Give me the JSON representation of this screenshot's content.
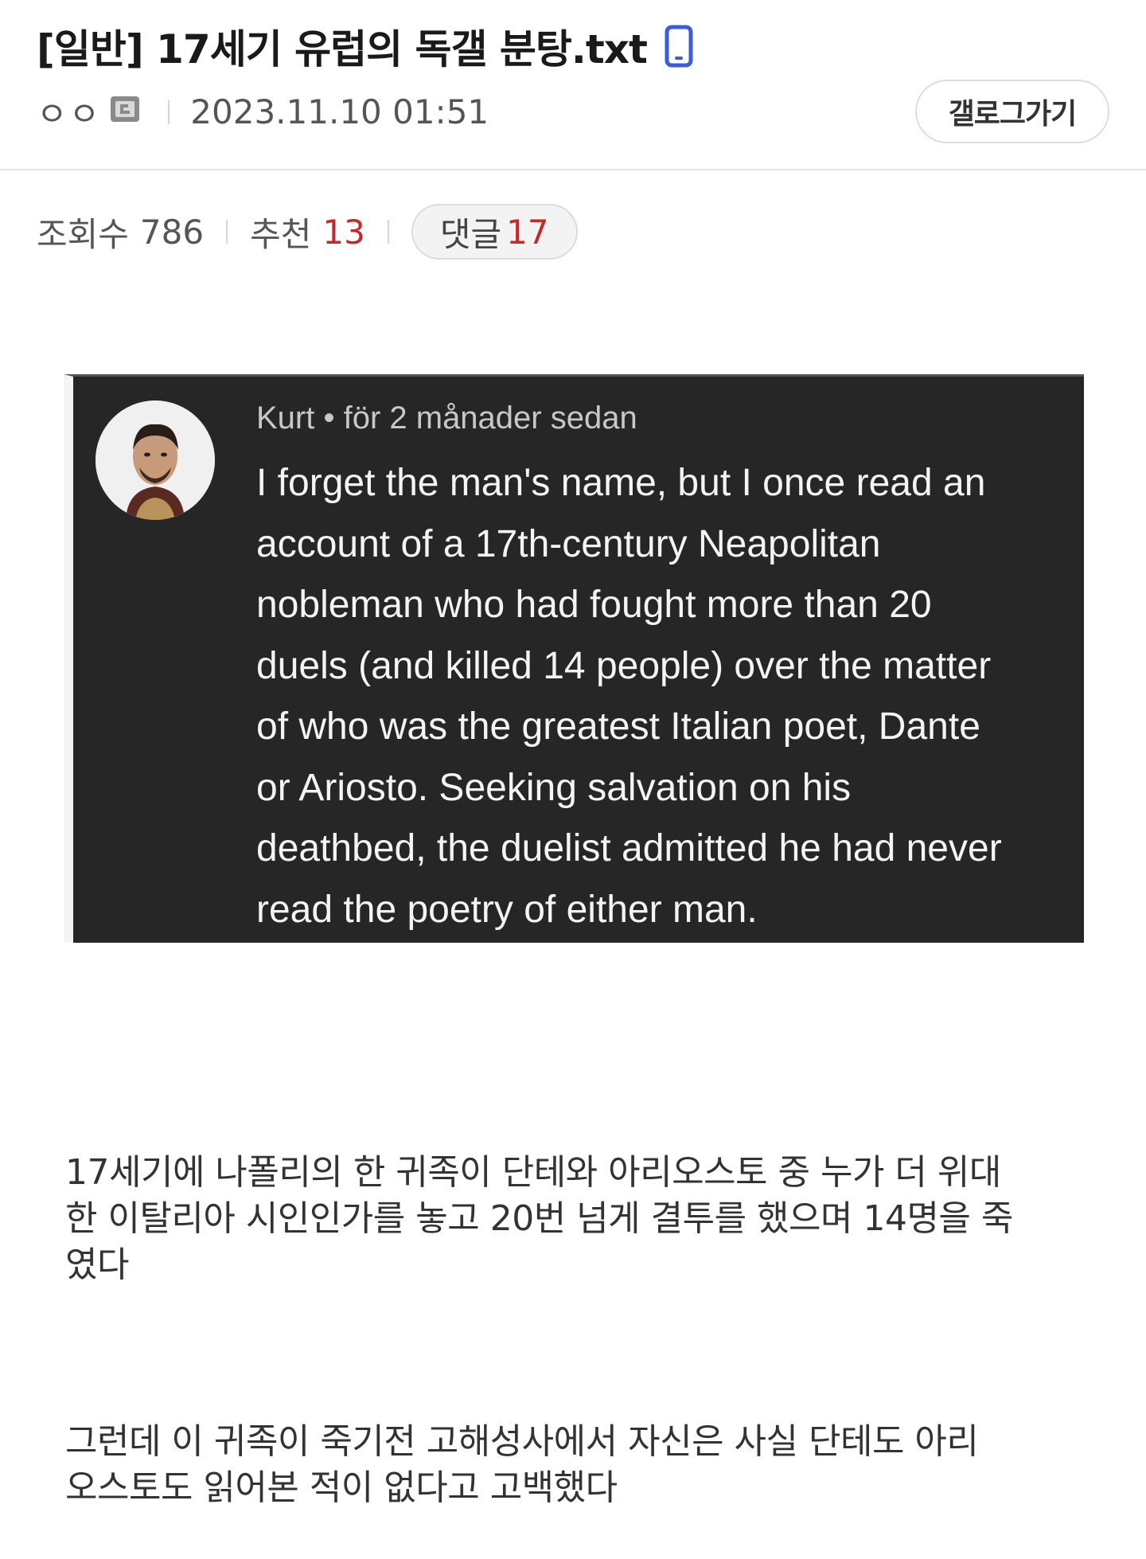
{
  "post": {
    "title": "[일반] 17세기 유럽의 독갤 분탕.txt",
    "author": "ㅇㅇ",
    "date": "2023.11.10 01:51",
    "gallog_button": "갤로그가기",
    "views_label": "조회수",
    "views": "786",
    "recommend_label": "추천",
    "recommend": "13",
    "comments_label": "댓글",
    "comments": "17"
  },
  "embed": {
    "meta": "Kurt • för 2 månader sedan",
    "lines": [
      "I forget the man's name, but I once read an",
      "account of a 17th-century Neapolitan",
      "nobleman who had fought more than 20",
      "duels (and killed 14 people) over the matter",
      "of who was the greatest Italian poet, Dante",
      "or Ariosto.  Seeking salvation on his",
      "deathbed, the duelist admitted he had never",
      "read the poetry of either man."
    ]
  },
  "body": {
    "p1_lines": [
      "17세기에 나폴리의 한 귀족이 단테와 아리오스토 중 누가 더 위대",
      "한 이탈리아 시인인가를 놓고 20번 넘게 결투를 했으며 14명을 죽",
      "였다"
    ],
    "p2_lines": [
      "그런데 이 귀족이 죽기전 고해성사에서 자신은 사실 단테도 아리",
      "오스토도 읽어본 적이 없다고 고백했다"
    ]
  }
}
